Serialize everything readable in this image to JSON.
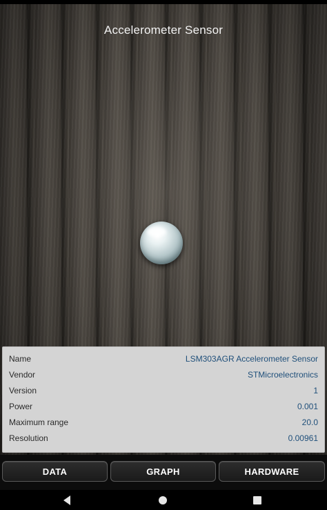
{
  "app": {
    "title": "Accelerometer Sensor"
  },
  "sensor_info": {
    "rows": [
      {
        "label": "Name",
        "value": "LSM303AGR Accelerometer Sensor"
      },
      {
        "label": "Vendor",
        "value": "STMicroelectronics"
      },
      {
        "label": "Version",
        "value": "1"
      },
      {
        "label": "Power",
        "value": "0.001"
      },
      {
        "label": "Maximum range",
        "value": "20.0"
      },
      {
        "label": "Resolution",
        "value": "0.00961"
      }
    ]
  },
  "tabs": [
    {
      "label": "DATA"
    },
    {
      "label": "GRAPH"
    },
    {
      "label": "HARDWARE"
    }
  ],
  "navigation": {
    "back_icon": "back-triangle-icon",
    "home_icon": "home-circle-icon",
    "recents_icon": "recents-square-icon"
  },
  "colors": {
    "value_text": "#1f4f7a",
    "panel_background": "#d4d4d4",
    "tab_background": "#1a1a1a"
  }
}
